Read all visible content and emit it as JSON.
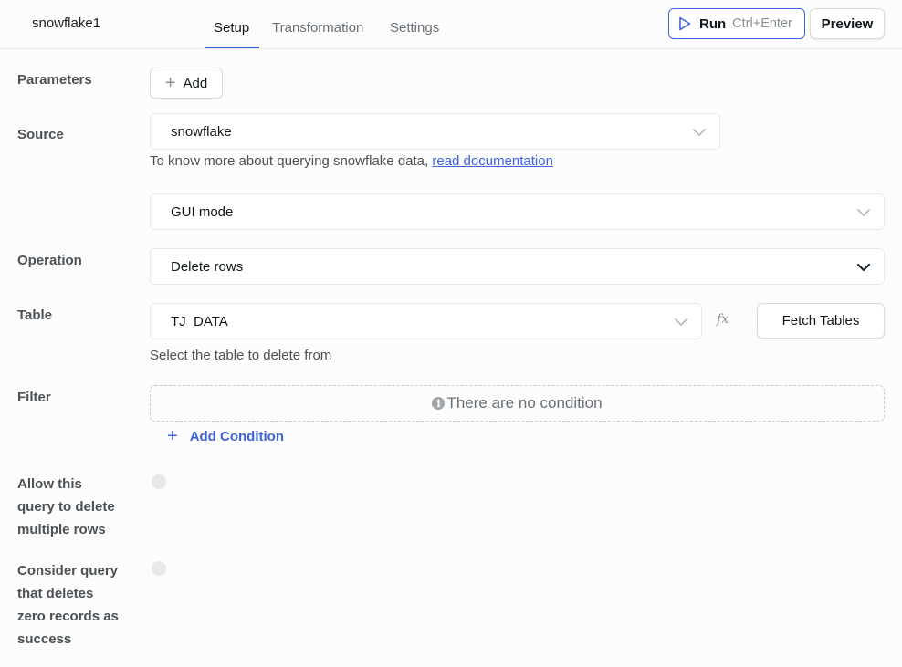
{
  "header": {
    "query_name": "snowflake1",
    "tabs": [
      {
        "label": "Setup",
        "active": true
      },
      {
        "label": "Transformation",
        "active": false
      },
      {
        "label": "Settings",
        "active": false
      }
    ],
    "run_label": "Run",
    "run_shortcut": "Ctrl+Enter",
    "preview_label": "Preview"
  },
  "form": {
    "parameters": {
      "label": "Parameters",
      "add_label": "Add"
    },
    "source": {
      "label": "Source",
      "value": "snowflake",
      "hint_text": "To know more about querying snowflake data, ",
      "hint_link": "read documentation"
    },
    "mode": {
      "value": "GUI mode"
    },
    "operation": {
      "label": "Operation",
      "value": "Delete rows"
    },
    "table": {
      "label": "Table",
      "value": "TJ_DATA",
      "fx_label": "fx",
      "fetch_label": "Fetch Tables",
      "hint": "Select the table to delete from"
    },
    "filter": {
      "label": "Filter",
      "empty_text": "There are no condition",
      "add_condition_label": "Add Condition"
    },
    "allow_multiple": {
      "label_lines": [
        "Allow this",
        "query to delete",
        "multiple rows"
      ],
      "enabled": false
    },
    "zero_success": {
      "label_lines": [
        "Consider query",
        "that deletes",
        "zero records as",
        "success"
      ],
      "enabled": false
    }
  },
  "colors": {
    "accent": "#3e63dd",
    "label": "#4c5155",
    "border": "#e6e8eb"
  }
}
